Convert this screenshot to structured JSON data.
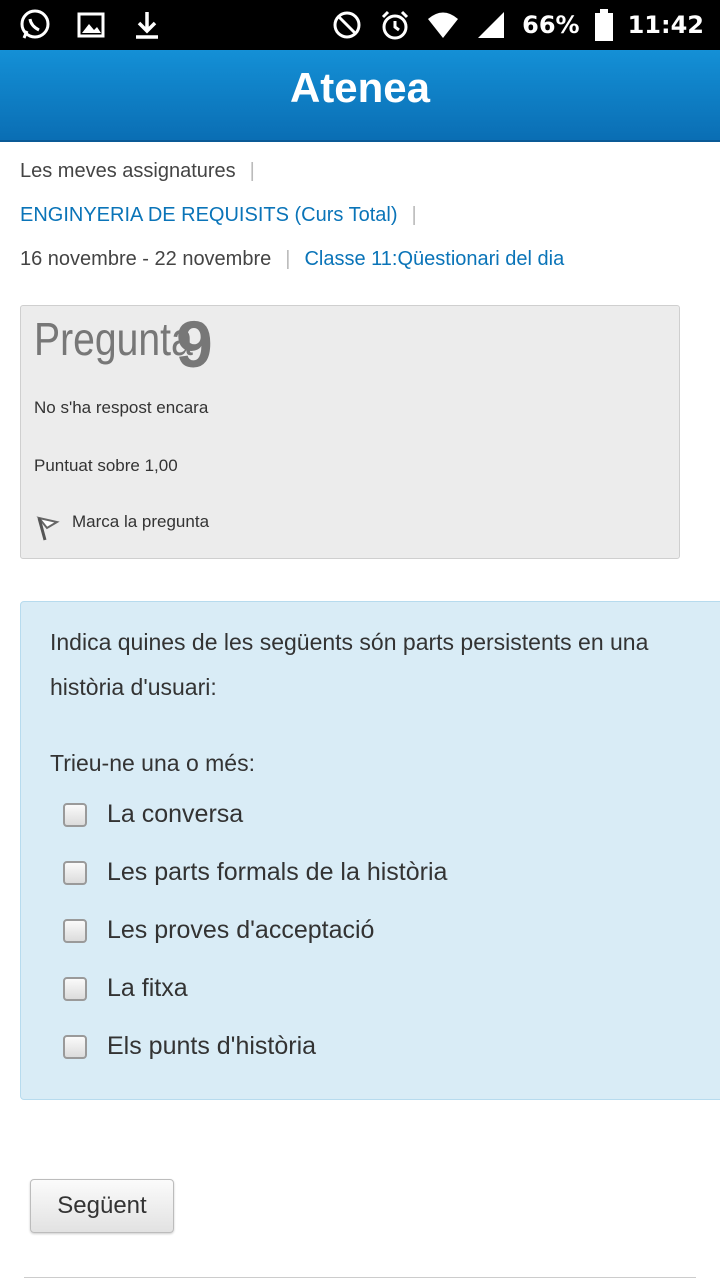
{
  "status_bar": {
    "left_icons": [
      "whatsapp-icon",
      "image-icon",
      "download-icon"
    ],
    "right_icons": [
      "do-not-disturb-icon",
      "alarm-icon",
      "wifi-icon",
      "signal-icon",
      "battery-icon"
    ],
    "battery": "66%",
    "time": "11:42"
  },
  "app": {
    "title": "Atenea",
    "accent": "#0a74b8",
    "header_color": "#1490d6"
  },
  "breadcrumb": {
    "my_courses": "Les meves assignatures",
    "course": "ENGINYERIA DE REQUISITS (Curs Total)",
    "week": "16 novembre - 22 novembre",
    "activity": "Classe 11:Qüestionari del dia",
    "separator": "|"
  },
  "question_info": {
    "label": "Pregunta",
    "number": "9",
    "state": "No s'ha respost encara",
    "grade": "Puntuat sobre 1,00",
    "flag_label": "Marca la pregunta"
  },
  "question": {
    "text": "Indica quines de les següents són parts persistents en una història d'usuari:",
    "prompt": "Trieu-ne una o més:",
    "options": [
      {
        "label": "La conversa",
        "checked": false
      },
      {
        "label": "Les parts formals de la història",
        "checked": false
      },
      {
        "label": "Les proves d'acceptació",
        "checked": false
      },
      {
        "label": "La fitxa",
        "checked": false
      },
      {
        "label": "Els punts d'història",
        "checked": false
      }
    ]
  },
  "navigation": {
    "next_label": "Següent"
  }
}
